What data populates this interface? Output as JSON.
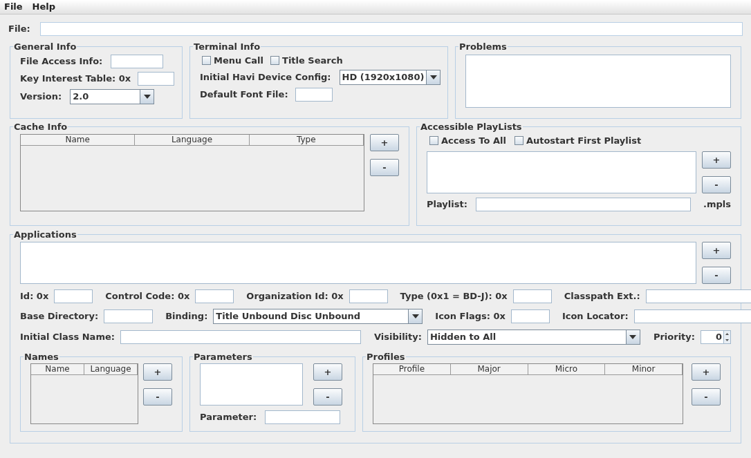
{
  "menu": [
    {
      "label": "File"
    },
    {
      "label": "Help"
    }
  ],
  "file_row": {
    "label": "File:"
  },
  "general_info": {
    "title": "General Info",
    "file_access_label": "File Access Info:",
    "key_interest_label": "Key Interest Table: 0x",
    "version_label": "Version:",
    "version": "2.0"
  },
  "terminal_info": {
    "title": "Terminal Info",
    "checkboxes": [
      {
        "label": "Menu Call",
        "checked": false
      },
      {
        "label": "Title Search",
        "checked": false
      }
    ],
    "havi_label": "Initial Havi Device Config:",
    "havi_value": "HD (1920x1080)",
    "font_label": "Default Font File:"
  },
  "problems": {
    "title": "Problems"
  },
  "cache_info": {
    "title": "Cache Info",
    "columns": [
      "Name",
      "Language",
      "Type"
    ],
    "buttons": [
      "+",
      "-"
    ]
  },
  "playlists": {
    "title": "Accessible PlayLists",
    "checkboxes": [
      {
        "label": "Access To All",
        "checked": false
      },
      {
        "label": "Autostart First Playlist",
        "checked": false
      }
    ],
    "buttons": [
      "+",
      "-"
    ],
    "playlist_label": "Playlist:",
    "suffix": ".mpls"
  },
  "applications": {
    "title": "Applications",
    "buttons": [
      "+",
      "-"
    ],
    "row_1": [
      {
        "kind": "text",
        "label": "Id: 0x"
      },
      {
        "kind": "text",
        "label": "Control Code: 0x"
      },
      {
        "kind": "text",
        "label": "Organization Id: 0x"
      },
      {
        "kind": "text",
        "label": "Type (0x1 = BD-J): 0x"
      },
      {
        "kind": "text",
        "label": "Classpath Ext.:"
      }
    ],
    "row_2": [
      {
        "kind": "text",
        "label": "Base Directory:"
      },
      {
        "kind": "combo",
        "label": "Binding:",
        "value": "Title Unbound Disc Unbound"
      },
      {
        "kind": "text",
        "label": "Icon Flags: 0x"
      },
      {
        "kind": "text",
        "label": "Icon Locator:"
      }
    ],
    "row_3": [
      {
        "kind": "text",
        "label": "Initial Class Name:"
      },
      {
        "kind": "combo",
        "label": "Visibility:",
        "value": "Hidden to All"
      },
      {
        "kind": "spinner",
        "label": "Priority:",
        "value": "0"
      }
    ],
    "names": {
      "title": "Names",
      "columns": [
        "Name",
        "Language"
      ],
      "buttons": [
        "+",
        "-"
      ]
    },
    "parameters": {
      "title": "Parameters",
      "buttons": [
        "+",
        "-"
      ],
      "parameter_label": "Parameter:"
    },
    "profiles": {
      "title": "Profiles",
      "columns": [
        "Profile",
        "Major",
        "Micro",
        "Minor"
      ],
      "buttons": [
        "+",
        "-"
      ]
    }
  }
}
